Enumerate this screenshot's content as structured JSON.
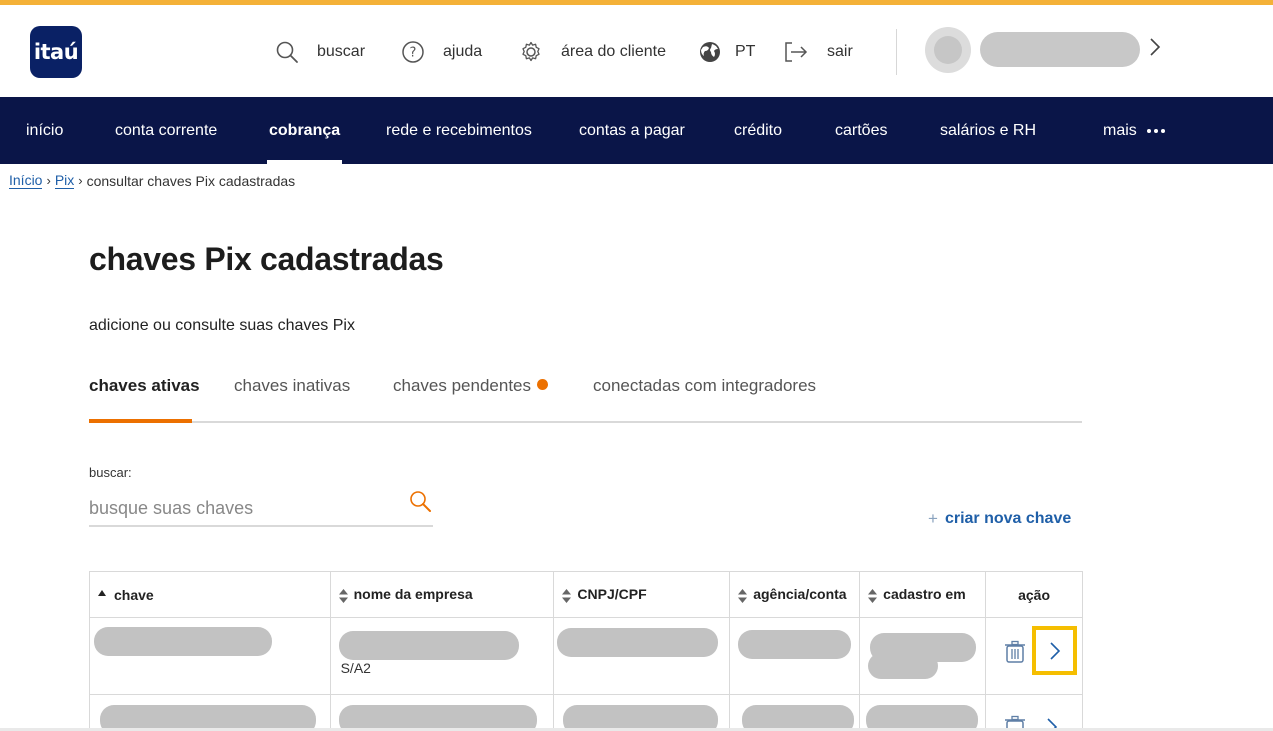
{
  "brand": {
    "logo_text": "itaú",
    "accent": "#f4b138",
    "nav_bg": "#0a1548",
    "orange": "#ec7000",
    "link": "#1f5fa8"
  },
  "header": {
    "search_label": "buscar",
    "help_label": "ajuda",
    "client_area_label": "área do cliente",
    "language_label": "PT",
    "logout_label": "sair"
  },
  "nav": {
    "items": [
      {
        "label": "início"
      },
      {
        "label": "conta corrente"
      },
      {
        "label": "cobrança",
        "active": true
      },
      {
        "label": "rede e recebimentos"
      },
      {
        "label": "contas a pagar"
      },
      {
        "label": "crédito"
      },
      {
        "label": "cartões"
      },
      {
        "label": "salários e RH"
      },
      {
        "label": "mais"
      }
    ]
  },
  "breadcrumb": {
    "home": "Início",
    "pix": "Pix",
    "current": "consultar chaves Pix cadastradas"
  },
  "page": {
    "title": "chaves Pix cadastradas",
    "subtitle": "adicione ou consulte suas chaves Pix"
  },
  "tabs": [
    {
      "label": "chaves ativas",
      "active": true
    },
    {
      "label": "chaves inativas"
    },
    {
      "label": "chaves pendentes",
      "badge": true
    },
    {
      "label": "conectadas com integradores"
    }
  ],
  "search": {
    "label": "buscar:",
    "placeholder": "busque suas chaves"
  },
  "create_key_label": "criar nova chave",
  "table": {
    "columns": [
      "chave",
      "nome da empresa",
      "CNPJ/CPF",
      "agência/conta",
      "cadastro em",
      "ação"
    ],
    "rows": [
      {
        "company_suffix": "S/A2"
      },
      {}
    ]
  },
  "icons": {
    "search": "search-icon",
    "help": "help-icon",
    "settings": "gear-icon",
    "language": "globe-icon",
    "logout": "logout-icon",
    "trash": "trash-icon",
    "chevron": "chevron-right-icon"
  }
}
